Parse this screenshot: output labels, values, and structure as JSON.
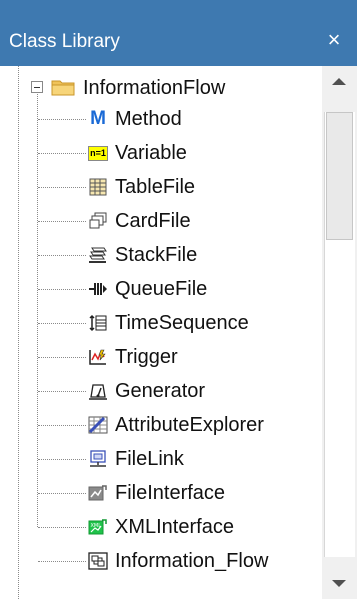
{
  "panel": {
    "title": "Class Library",
    "close_glyph": "×"
  },
  "tree": {
    "root": {
      "label": "InformationFlow",
      "icon": "folder-icon",
      "expanded": true
    },
    "items": [
      {
        "label": "Method",
        "icon": "method-icon"
      },
      {
        "label": "Variable",
        "icon": "variable-icon"
      },
      {
        "label": "TableFile",
        "icon": "table-file-icon"
      },
      {
        "label": "CardFile",
        "icon": "card-file-icon"
      },
      {
        "label": "StackFile",
        "icon": "stack-file-icon"
      },
      {
        "label": "QueueFile",
        "icon": "queue-file-icon"
      },
      {
        "label": "TimeSequence",
        "icon": "time-sequence-icon"
      },
      {
        "label": "Trigger",
        "icon": "trigger-icon"
      },
      {
        "label": "Generator",
        "icon": "generator-icon"
      },
      {
        "label": "AttributeExplorer",
        "icon": "attribute-explorer-icon"
      },
      {
        "label": "FileLink",
        "icon": "file-link-icon"
      },
      {
        "label": "FileInterface",
        "icon": "file-interface-icon"
      },
      {
        "label": "XMLInterface",
        "icon": "xml-interface-icon"
      },
      {
        "label": "Information_Flow",
        "icon": "information-flow-icon"
      }
    ]
  },
  "icon_texts": {
    "method": "M",
    "variable": "n=1",
    "xml": "XML"
  },
  "colors": {
    "title_bar": "#3e79b0",
    "title_text": "#ffffff",
    "method_icon": "#1a6ad6",
    "variable_icon_bg": "#ffff00"
  }
}
